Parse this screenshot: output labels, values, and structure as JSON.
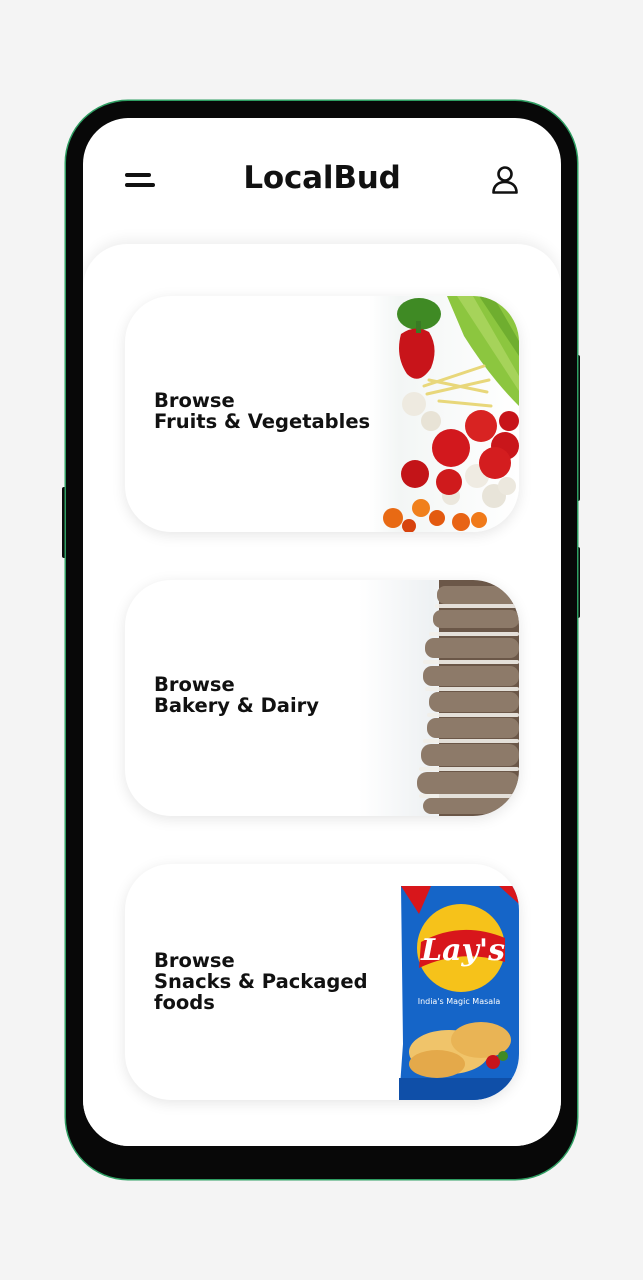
{
  "app": {
    "title": "LocalBud"
  },
  "header": {
    "menu_icon": "menu-icon",
    "profile_icon": "user-icon"
  },
  "categories": [
    {
      "line1": "Browse",
      "line2": "Fruits & Vegetables",
      "line3": "",
      "image": "vegetables-image"
    },
    {
      "line1": "Browse",
      "line2": "Bakery & Dairy",
      "line3": "",
      "image": "bread-loaf-image"
    },
    {
      "line1": "Browse",
      "line2": "Snacks & Packaged",
      "line3": "foods",
      "image": "lays-chips-packet-image",
      "packet": {
        "brand": "Lay's",
        "flavor": "India's Magic Masala"
      }
    }
  ],
  "colors": {
    "background": "#f4f4f4",
    "phone_frame": "#080808",
    "frame_accent": "#2e9e62",
    "text": "#111111",
    "lays_red": "#d8161b",
    "lays_yellow": "#f6c21a",
    "packet_blue": "#1565c8"
  }
}
